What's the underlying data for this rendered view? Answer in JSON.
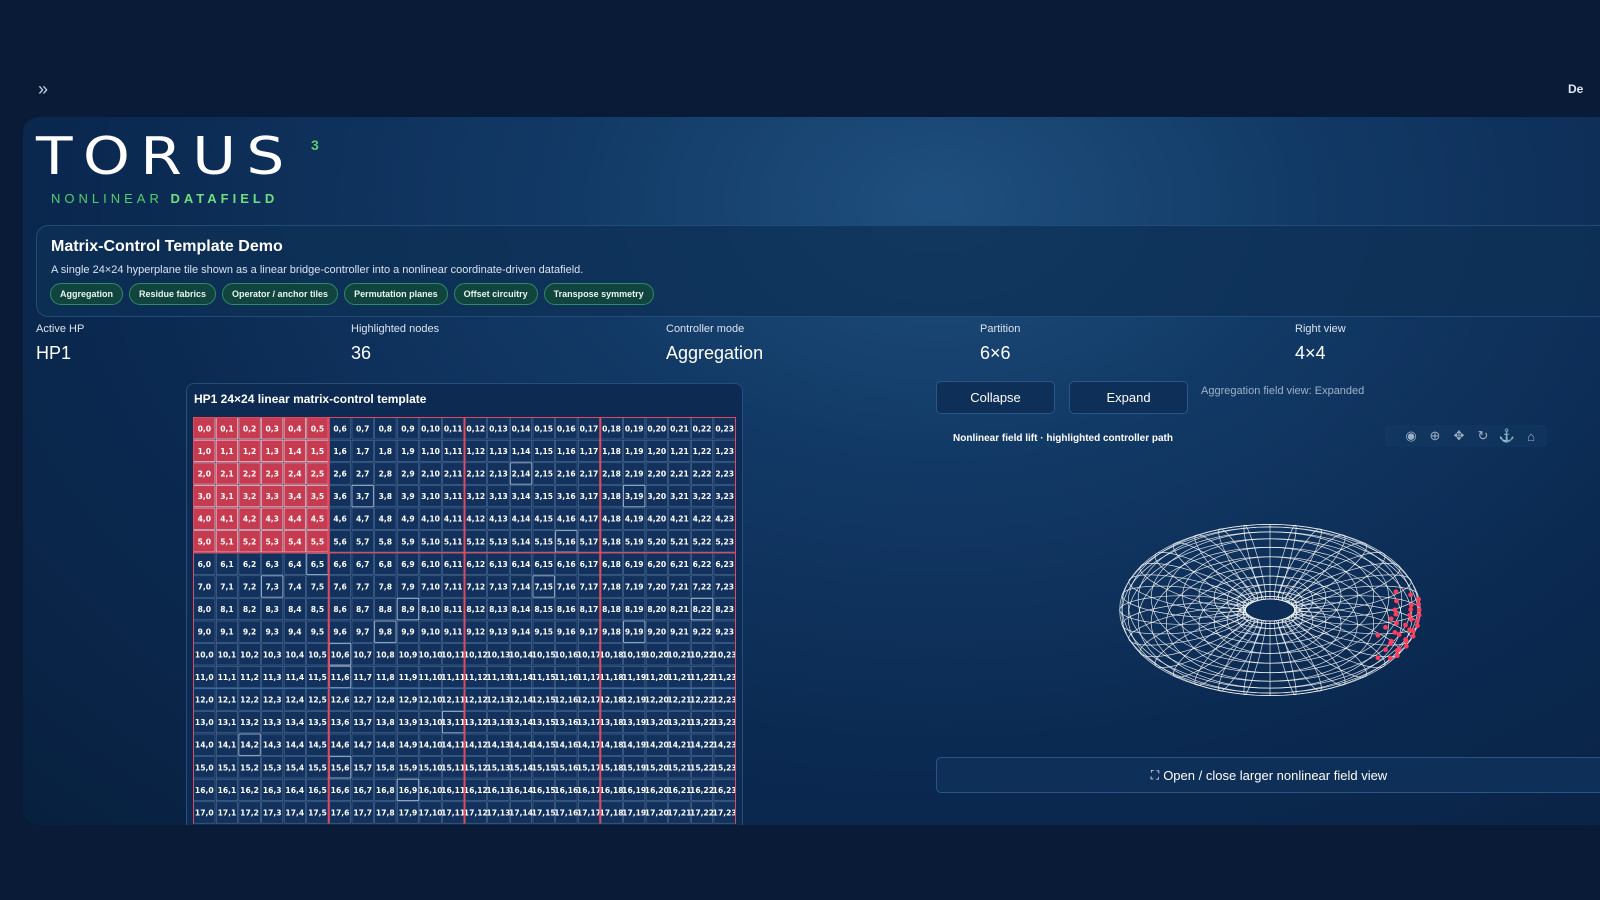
{
  "topbar": {
    "toggle_icon": "double-chevron-right-icon",
    "right_stub": "De"
  },
  "logo": {
    "word": "TORUS",
    "sup": "3",
    "sub_a": "NONLINEAR",
    "sub_b": "DATAFIELD"
  },
  "banner": {
    "title": "Matrix-Control Template Demo",
    "description": "A single 24×24 hyperplane tile shown as a linear bridge-controller into a nonlinear coordinate-driven datafield.",
    "chips": [
      "Aggregation",
      "Residue fabrics",
      "Operator / anchor tiles",
      "Permutation planes",
      "Offset circuitry",
      "Transpose symmetry"
    ]
  },
  "metrics": [
    {
      "label": "Active HP",
      "value": "HP1"
    },
    {
      "label": "Highlighted nodes",
      "value": "36"
    },
    {
      "label": "Controller mode",
      "value": "Aggregation"
    },
    {
      "label": "Partition",
      "value": "6×6"
    },
    {
      "label": "Right view",
      "value": "4×4"
    }
  ],
  "matrix": {
    "title": "HP1 24×24 linear matrix-control template",
    "size": 24,
    "visible_rows": 18,
    "highlight_rows": 6,
    "highlight_cols": 6,
    "partition": 6,
    "highlight_color": "#c73b50",
    "partition_color": "#e04a5e"
  },
  "controls": {
    "collapse": "Collapse",
    "expand": "Expand",
    "status": "Aggregation field view: Expanded"
  },
  "plot": {
    "title": "Nonlinear field lift · highlighted controller path",
    "toolbar": [
      "camera-icon",
      "zoom-icon",
      "pan-icon",
      "rotate-icon",
      "orbit-icon",
      "home-icon"
    ],
    "highlight_color": "#ff3c5a"
  },
  "open_button": {
    "icon": "expand-icon",
    "label": "Open / close larger nonlinear field view"
  }
}
